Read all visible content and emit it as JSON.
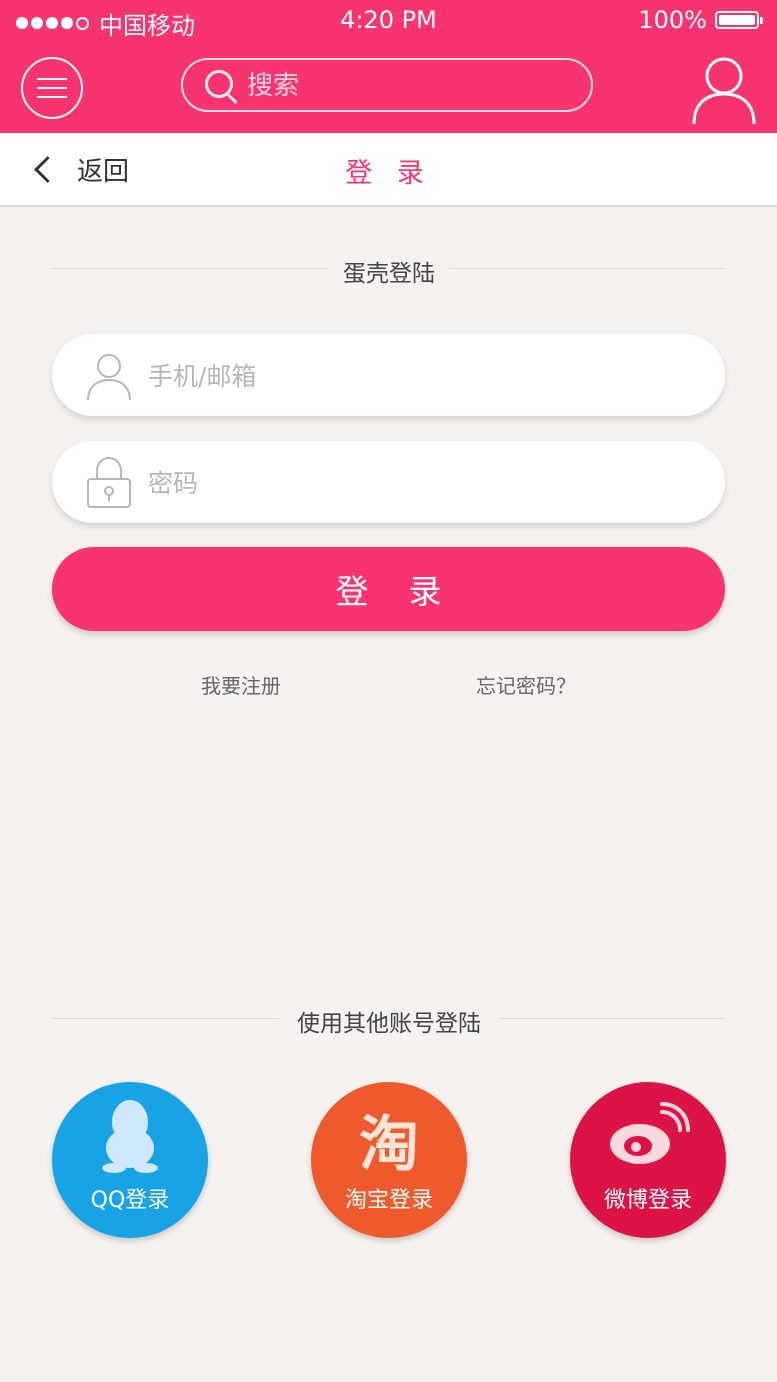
{
  "status_bar": {
    "carrier": "中国移动",
    "time": "4:20 PM",
    "battery": "100%"
  },
  "header": {
    "search_placeholder": "搜索"
  },
  "navbar": {
    "back_label": "返回",
    "title": "登 录"
  },
  "login": {
    "section_title": "蛋壳登陆",
    "account_placeholder": "手机/邮箱",
    "password_placeholder": "密码",
    "submit_label": "登录",
    "register_link": "我要注册",
    "forgot_link": "忘记密码？"
  },
  "social": {
    "section_title": "使用其他账号登陆",
    "items": [
      {
        "label": "QQ登录",
        "color": "#18a3e6",
        "icon": "qq-penguin-icon"
      },
      {
        "label": "淘宝登录",
        "color": "#ee5a2b",
        "icon": "taobao-icon",
        "glyph": "淘"
      },
      {
        "label": "微博登录",
        "color": "#dc1446",
        "icon": "weibo-icon"
      }
    ]
  },
  "colors": {
    "accent": "#f7346f",
    "background": "#f4f1ee"
  }
}
